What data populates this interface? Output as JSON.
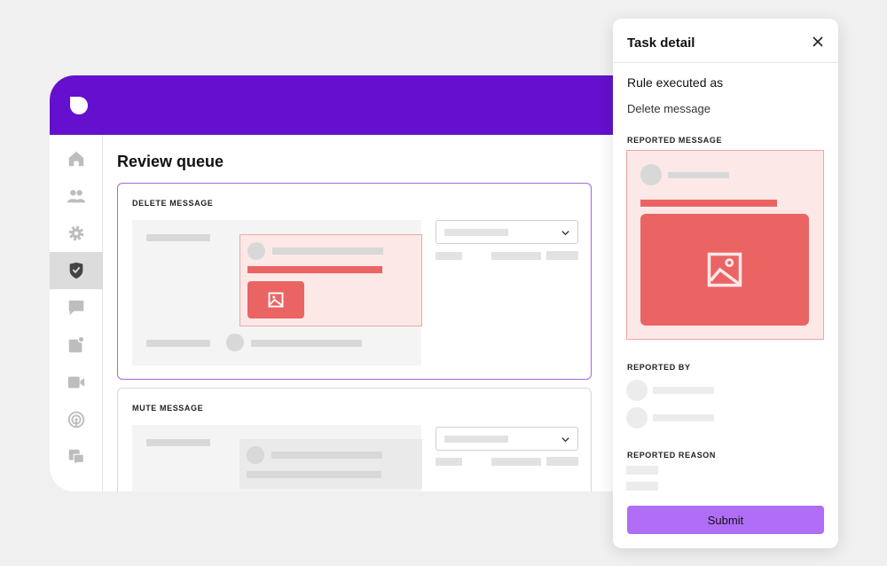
{
  "app": {
    "page_title": "Review queue",
    "nav_items": [
      {
        "icon": "home-icon"
      },
      {
        "icon": "users-icon"
      },
      {
        "icon": "gear-icon"
      },
      {
        "icon": "shield-check-icon",
        "active": true
      },
      {
        "icon": "chat-icon"
      },
      {
        "icon": "notification-icon"
      },
      {
        "icon": "video-icon"
      },
      {
        "icon": "broadcast-icon"
      },
      {
        "icon": "chat-bubbles-icon"
      }
    ],
    "cards": [
      {
        "label": "DELETE MESSAGE"
      },
      {
        "label": "MUTE MESSAGE"
      }
    ]
  },
  "panel": {
    "title": "Task detail",
    "rule_title": "Rule executed as",
    "rule_value": "Delete message",
    "reported_message_label": "REPORTED MESSAGE",
    "reported_by_label": "REPORTED BY",
    "reported_reason_label": "REPORTED REASON",
    "submit_label": "Submit"
  },
  "colors": {
    "brand": "#6410ce",
    "accent": "#b06ef7",
    "alert": "#eb6464",
    "alert_bg": "#fde8e8"
  }
}
